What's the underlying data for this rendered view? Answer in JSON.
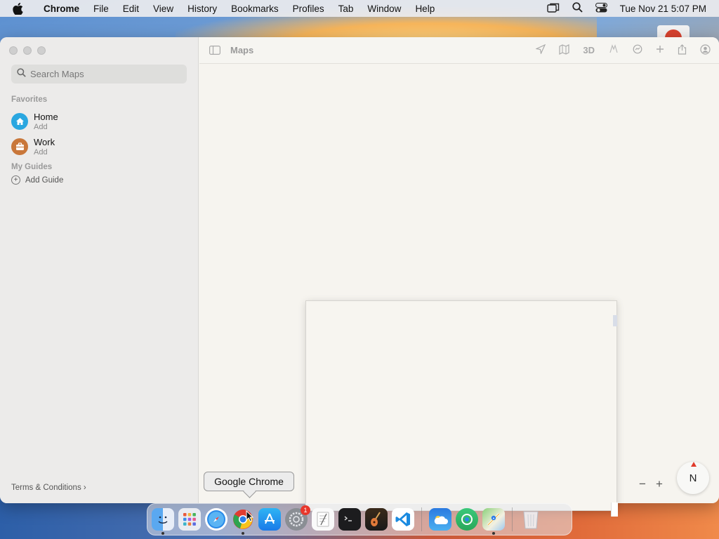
{
  "menubar": {
    "app_name": "Chrome",
    "items": [
      "File",
      "Edit",
      "View",
      "History",
      "Bookmarks",
      "Profiles",
      "Tab",
      "Window",
      "Help"
    ],
    "clock": "Tue Nov 21  5:07 PM"
  },
  "sidebar": {
    "search_placeholder": "Search Maps",
    "favorites_title": "Favorites",
    "favorites": [
      {
        "name": "Home",
        "sub": "Add",
        "color": "#2aa7e0"
      },
      {
        "name": "Work",
        "sub": "Add",
        "color": "#c9773a"
      }
    ],
    "guides_title": "My Guides",
    "add_guide_label": "Add Guide",
    "terms_label": "Terms & Conditions"
  },
  "toolbar": {
    "title": "Maps",
    "three_d_label": "3D"
  },
  "map": {
    "compass_label": "N",
    "zoom_out": "−",
    "zoom_in": "+"
  },
  "dock": {
    "tooltip": "Google Chrome",
    "apps": [
      "Finder",
      "Launchpad",
      "Safari",
      "Google Chrome",
      "App Store",
      "System Settings",
      "TextEdit",
      "Terminal",
      "GarageBand",
      "Visual Studio Code",
      "Weather",
      "Find My",
      "Maps",
      "Trash"
    ],
    "system_settings_badge": "1"
  }
}
